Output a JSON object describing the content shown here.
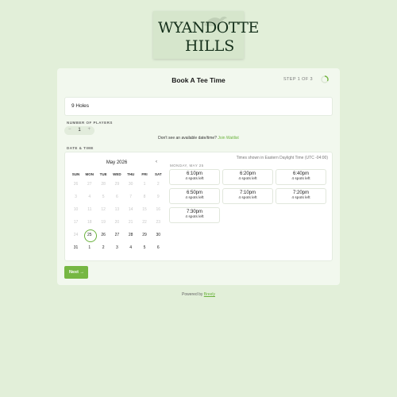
{
  "logo": {
    "line1": "WYANDOTTE",
    "line2": "HILLS"
  },
  "header": {
    "title": "Book A Tee Time",
    "step": "STEP 1 OF 3"
  },
  "holes": {
    "selected": "9 Holes"
  },
  "players": {
    "label": "NUMBER OF PLAYERS",
    "minus": "−",
    "value": "1",
    "plus": "+"
  },
  "waitlist": {
    "text": "Don't see an available date/time?",
    "link": "Join Waitlist"
  },
  "datetime": {
    "label": "DATE & TIME",
    "month": "May 2026",
    "prev": "‹",
    "weekdays": [
      "SUN",
      "MON",
      "TUE",
      "WED",
      "THU",
      "FRI",
      "SAT"
    ],
    "weeks": [
      [
        "26",
        "27",
        "28",
        "29",
        "30",
        "1",
        "2"
      ],
      [
        "3",
        "4",
        "5",
        "6",
        "7",
        "8",
        "9"
      ],
      [
        "10",
        "11",
        "12",
        "13",
        "14",
        "15",
        "16"
      ],
      [
        "17",
        "18",
        "19",
        "20",
        "21",
        "22",
        "23"
      ],
      [
        "24",
        "25",
        "26",
        "27",
        "28",
        "29",
        "30"
      ],
      [
        "31",
        "1",
        "2",
        "3",
        "4",
        "5",
        "6"
      ]
    ],
    "selected_day": "25",
    "timezone": "Times shown in Eastern Daylight Time (UTC -04:00)",
    "date_heading": "MONDAY, MAY 25",
    "slots": [
      {
        "time": "6:10pm",
        "spots": "4 spots left"
      },
      {
        "time": "6:20pm",
        "spots": "4 spots left"
      },
      {
        "time": "6:40pm",
        "spots": "4 spots left"
      },
      {
        "time": "6:50pm",
        "spots": "4 spots left"
      },
      {
        "time": "7:10pm",
        "spots": "4 spots left"
      },
      {
        "time": "7:20pm",
        "spots": "4 spots left"
      },
      {
        "time": "7:30pm",
        "spots": "4 spots left"
      }
    ]
  },
  "actions": {
    "next": "Next →"
  },
  "footer": {
    "text": "Powered by",
    "link": "Breely"
  },
  "colors": {
    "accent": "#76b743",
    "background": "#e2efd9",
    "card": "#f2f8ee"
  }
}
